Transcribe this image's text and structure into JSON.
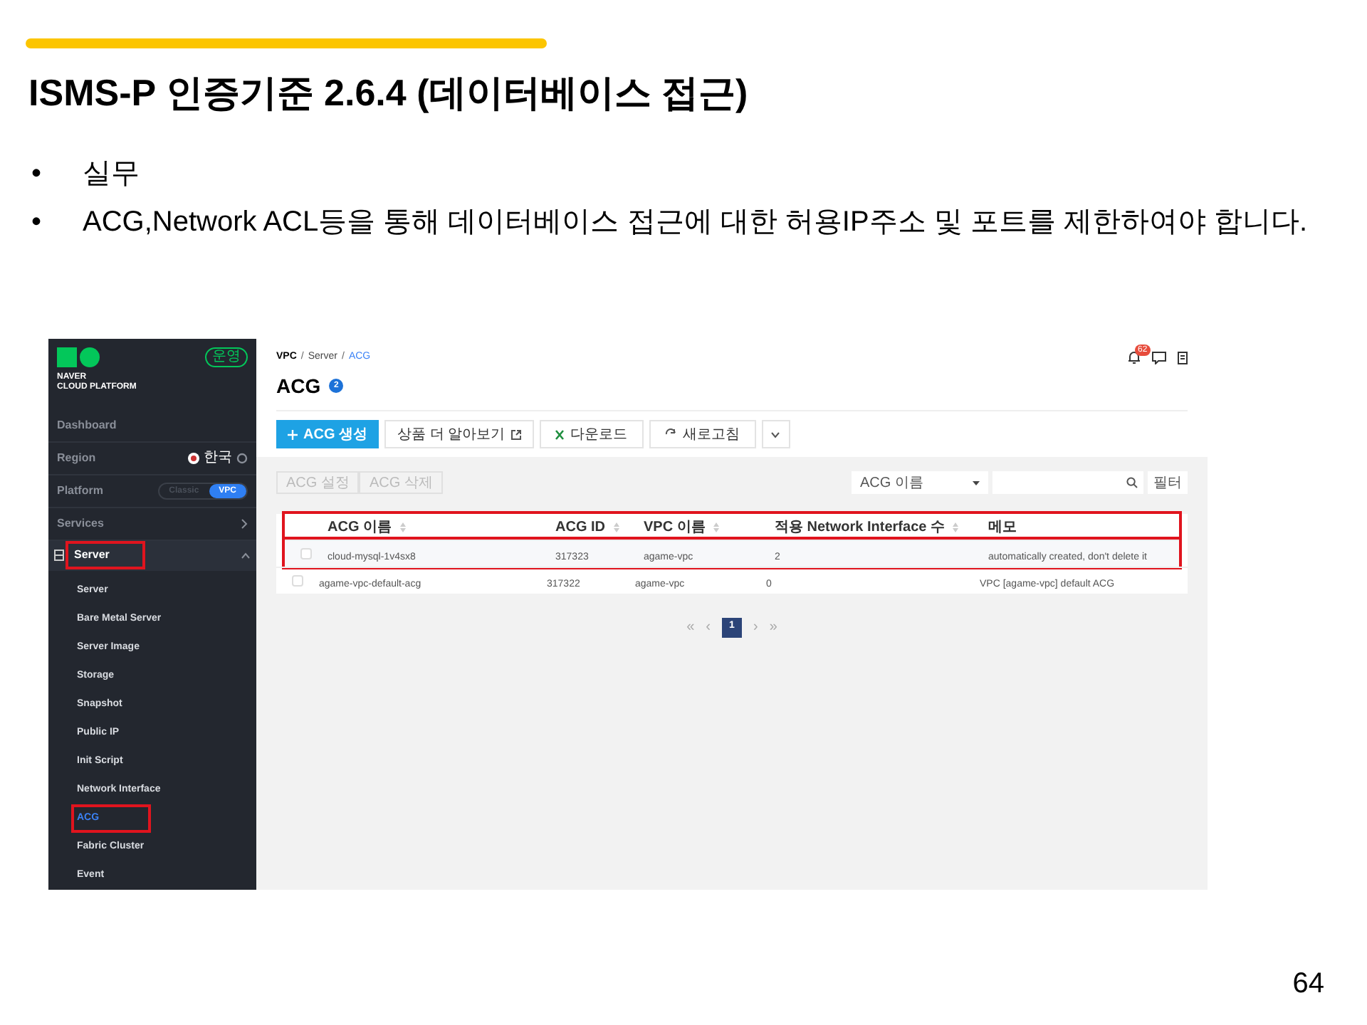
{
  "slide": {
    "title": "ISMS-P 인증기준 2.6.4 (데이터베이스 접근)",
    "bullets": [
      "실무",
      "ACG,Network ACL등을 통해 데이터베이스 접근에 대한 허용IP주소 및 포트를 제한하여야 합니다."
    ],
    "bullet_mark": "•",
    "page_number": "64"
  },
  "console": {
    "sidebar": {
      "brand": [
        "NAVER",
        "CLOUD PLATFORM"
      ],
      "badge": "운영",
      "dashboard": "Dashboard",
      "region": {
        "label": "Region",
        "value": "한국"
      },
      "platform": {
        "label": "Platform",
        "options": [
          {
            "label": "Classic",
            "selected": false
          },
          {
            "label": "VPC",
            "selected": true
          }
        ]
      },
      "services": "Services",
      "group": {
        "label": "Server",
        "expanded": true,
        "highlighted": true,
        "items": [
          {
            "label": "Server",
            "selected": false,
            "highlighted": false
          },
          {
            "label": "Bare Metal Server",
            "selected": false,
            "highlighted": false
          },
          {
            "label": "Server Image",
            "selected": false,
            "highlighted": false
          },
          {
            "label": "Storage",
            "selected": false,
            "highlighted": false
          },
          {
            "label": "Snapshot",
            "selected": false,
            "highlighted": false
          },
          {
            "label": "Public IP",
            "selected": false,
            "highlighted": false
          },
          {
            "label": "Init Script",
            "selected": false,
            "highlighted": false
          },
          {
            "label": "Network Interface",
            "selected": false,
            "highlighted": false
          },
          {
            "label": "ACG",
            "selected": true,
            "highlighted": true
          },
          {
            "label": "Fabric Cluster",
            "selected": false,
            "highlighted": false
          },
          {
            "label": "Event",
            "selected": false,
            "highlighted": false
          }
        ]
      }
    },
    "breadcrumb": {
      "separator": "/",
      "items": [
        "VPC",
        "Server",
        "ACG"
      ]
    },
    "page_title": "ACG",
    "count": "2",
    "notifications": "62",
    "toolbar": [
      {
        "kind": "primary",
        "label": "ACG 생성"
      },
      {
        "kind": "link",
        "label": "상품 더 알아보기"
      },
      {
        "kind": "excel",
        "label": "다운로드"
      },
      {
        "kind": "refresh",
        "label": "새로고침"
      },
      {
        "kind": "more"
      }
    ],
    "actions": [
      {
        "label": "ACG 설정",
        "disabled": true
      },
      {
        "label": "ACG 삭제",
        "disabled": true
      }
    ],
    "search": {
      "field": "ACG 이름",
      "filter": "필터"
    },
    "table": {
      "header_highlighted": true,
      "columns": [
        {
          "label": "ACG 이름",
          "sortable": true
        },
        {
          "label": "ACG ID",
          "sortable": true
        },
        {
          "label": "VPC 이름",
          "sortable": true
        },
        {
          "label": "적용 Network Interface 수",
          "sortable": true
        },
        {
          "label": "메모",
          "sortable": false
        }
      ],
      "rows": [
        {
          "checked": false,
          "highlighted": true,
          "cells": [
            "cloud-mysql-1v4sx8",
            "317323",
            "agame-vpc",
            "2",
            "automatically created, don't delete it"
          ]
        },
        {
          "checked": false,
          "highlighted": false,
          "cells": [
            "agame-vpc-default-acg",
            "317322",
            "agame-vpc",
            "0",
            "VPC [agame-vpc] default ACG"
          ]
        }
      ]
    },
    "pagination": {
      "first": "«",
      "prev": "‹",
      "pages": [
        {
          "label": "1",
          "selected": true
        }
      ],
      "next": "›",
      "last": "»"
    }
  }
}
